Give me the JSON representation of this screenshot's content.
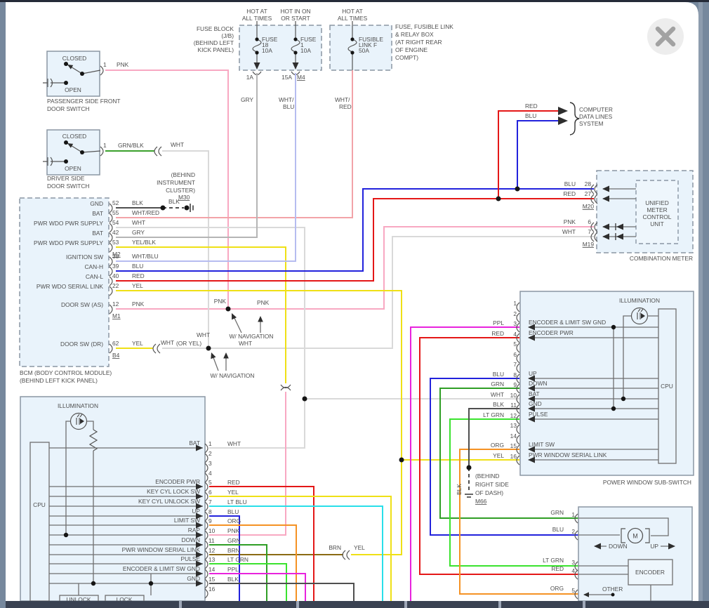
{
  "palette": {
    "PNK": "#f8a8c2",
    "RED": "#e41717",
    "BLU": "#2222dc",
    "YEL": "#efe016",
    "GRN": "#2f9e25",
    "LT_GRN": "#3ae32e",
    "LT_BLU": "#29dfe9",
    "ORG": "#f59224",
    "BRN": "#8a6b14",
    "PPL": "#e823dd",
    "BLK": "#4f4f4f",
    "WHT": "#d9d9d9",
    "GRY": "#b5b5b5",
    "WHT_RED": "#f2a3a8",
    "WHT_BLU": "#b6bcf0",
    "GRN_BLK": "#3aa02c",
    "YEL_BLK": "#efe016"
  },
  "fuses": {
    "jb": [
      "FUSE BLOCK",
      "(J/B)",
      "(BEHIND LEFT",
      "KICK PANEL)"
    ],
    "hot_all": [
      "HOT AT",
      "ALL TIMES"
    ],
    "hot_ign": [
      "HOT IN ON",
      "OR START"
    ],
    "f18": [
      "FUSE",
      "18",
      "10A"
    ],
    "f1": [
      "FUSE",
      "1",
      "10A"
    ],
    "flink": [
      "FUSIBLE",
      "LINK F",
      "50A"
    ],
    "relay": [
      "FUSE, FUSIBLE LINK",
      "& RELAY BOX",
      "(AT RIGHT REAR",
      "OF ENGINE",
      "COMPT)"
    ],
    "a1": "1A",
    "a15": "15A",
    "m4": "M4"
  },
  "switches": {
    "passenger": {
      "closed": "CLOSED",
      "open": "OPEN",
      "pin": "1",
      "wire": "PNK",
      "cap": [
        "PASSENGER SIDE FRONT",
        "DOOR SWITCH"
      ]
    },
    "driver": {
      "closed": "CLOSED",
      "open": "OPEN",
      "pin": "1",
      "wire": "GRN/BLK",
      "conn": "WHT",
      "cap": [
        "DRIVER SIDE",
        "DOOR SWITCH"
      ]
    }
  },
  "bcm": {
    "rows": [
      {
        "n": "52",
        "w": "BLK",
        "s": "GND"
      },
      {
        "n": "55",
        "w": "WHT/RED",
        "s": "BAT"
      },
      {
        "n": "54",
        "w": "WHT",
        "s": "PWR WDO PWR SUPPLY"
      },
      {
        "n": "42",
        "w": "GRY",
        "s": "BAT"
      },
      {
        "n": "53",
        "w": "YEL/BLK",
        "s": "PWR WDO PWR SUPPLY"
      },
      {
        "n": "38",
        "w": "WHT/BLU",
        "s": "IGNITION SW"
      },
      {
        "n": "39",
        "w": "BLU",
        "s": "CAN-H"
      },
      {
        "n": "40",
        "w": "RED",
        "s": "CAN-L"
      },
      {
        "n": "22",
        "w": "YEL",
        "s": "PWR WDO SERIAL LINK"
      },
      {
        "n": "12",
        "w": "PNK",
        "s": "DOOR SW (AS)"
      },
      {
        "n": "62",
        "w": "YEL",
        "s": "DOOR SW (DR)"
      }
    ],
    "m2": "M2",
    "m1": "M1",
    "b4": "B4",
    "row62": {
      "wht": "WHT",
      "or_yel": "(OR YEL)"
    },
    "cap": [
      "BCM (BODY CONTROL MODULE)",
      "(BEHIND LEFT KICK PANEL)"
    ]
  },
  "m30": {
    "blk": "BLK",
    "id": "M30",
    "lines": [
      "(BEHIND",
      "INSTRUMENT",
      "CLUSTER)"
    ]
  },
  "m66": {
    "blk": "BLK",
    "id": "M66",
    "lines": [
      "(BEHIND",
      "RIGHT SIDE",
      "OF DASH)"
    ]
  },
  "datalines": {
    "red": "RED",
    "blu": "BLU",
    "lines": [
      "COMPUTER",
      "DATA LINES",
      "SYSTEM"
    ]
  },
  "meter": {
    "rows": [
      {
        "w": "BLU",
        "n": "28"
      },
      {
        "w": "RED",
        "n": "27"
      },
      {
        "w": "PNK",
        "n": "6"
      },
      {
        "w": "WHT",
        "n": "7"
      }
    ],
    "m20": "M20",
    "m19": "M19",
    "unit": [
      "UNIFIED",
      "METER",
      "CONTROL",
      "UNIT"
    ],
    "cap": "COMBINATION METER"
  },
  "mid": {
    "pnk_v": "PNK",
    "pnk_h": "PNK",
    "wht_v": "WHT",
    "wht_cont": "WHT",
    "nav": "W/ NAVIGATION",
    "brn": "BRN",
    "yel": "YEL",
    "gry": "GRY",
    "wht_blu": [
      "WHT/",
      "BLU"
    ],
    "wht_red": [
      "WHT/",
      "RED"
    ]
  },
  "sub": {
    "illum": "ILLUMINATION",
    "cpu": "CPU",
    "cap": "POWER WINDOW SUB-SWITCH",
    "pins": [
      {
        "n": "1"
      },
      {
        "n": "2"
      },
      {
        "n": "3",
        "w": "PPL",
        "s": "ENCODER & LIMIT SW GND"
      },
      {
        "n": "4",
        "w": "RED",
        "s": "ENCODER PWR"
      },
      {
        "n": "5"
      },
      {
        "n": "6"
      },
      {
        "n": "7"
      },
      {
        "n": "8",
        "w": "BLU",
        "s": "UP"
      },
      {
        "n": "9",
        "w": "GRN",
        "s": "DOWN"
      },
      {
        "n": "10",
        "w": "WHT",
        "s": "BAT"
      },
      {
        "n": "11",
        "w": "BLK",
        "s": "GND"
      },
      {
        "n": "12",
        "w": "LT GRN",
        "s": "PULSE"
      },
      {
        "n": "13"
      },
      {
        "n": "14"
      },
      {
        "n": "15",
        "w": "ORG",
        "s": "LIMIT SW"
      },
      {
        "n": "16",
        "w": "YEL",
        "s": "PWR WINDOW SERIAL LINK"
      }
    ]
  },
  "main": {
    "illum": "ILLUMINATION",
    "cpu": "CPU",
    "unlock": "UNLOCK",
    "lock": "LOCK",
    "pins": [
      {
        "n": "1",
        "w": "WHT",
        "s": "BAT"
      },
      {
        "n": "2"
      },
      {
        "n": "3"
      },
      {
        "n": "4"
      },
      {
        "n": "5",
        "w": "RED",
        "s": "ENCODER PWR"
      },
      {
        "n": "6",
        "w": "YEL",
        "s": "KEY CYL LOCK SW"
      },
      {
        "n": "7",
        "w": "LT BLU",
        "s": "KEY CYL UNLOCK SW"
      },
      {
        "n": "8",
        "w": "BLU",
        "s": "UP"
      },
      {
        "n": "9",
        "w": "ORG",
        "s": "LIMIT SW"
      },
      {
        "n": "10",
        "w": "PNK",
        "s": "RAP"
      },
      {
        "n": "11",
        "w": "GRN",
        "s": "DOWN"
      },
      {
        "n": "12",
        "w": "BRN",
        "s": "PWR WINDOW SERIAL LINK"
      },
      {
        "n": "13",
        "w": "LT GRN",
        "s": "PULSE"
      },
      {
        "n": "14",
        "w": "PPL",
        "s": "ENCODER & LIMIT SW GND"
      },
      {
        "n": "15",
        "w": "BLK",
        "s": "GND"
      },
      {
        "n": "16"
      }
    ]
  },
  "motor": {
    "pins": [
      {
        "w": "GRN",
        "n": "1"
      },
      {
        "w": "BLU",
        "n": "2"
      },
      {
        "w": "LT GRN",
        "n": "3"
      },
      {
        "w": "RED",
        "n": "4"
      },
      {
        "w": "ORG",
        "n": "5"
      }
    ],
    "m": "M",
    "down": "DOWN",
    "up": "UP",
    "encoder": "ENCODER",
    "other": "OTHER"
  }
}
